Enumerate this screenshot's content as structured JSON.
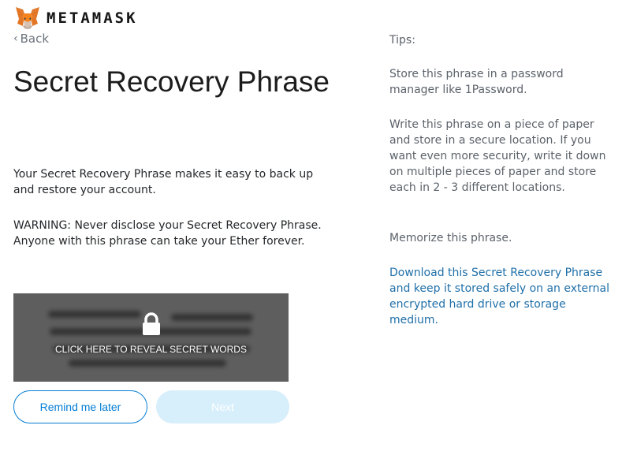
{
  "header": {
    "wordmark": "METAMASK",
    "logo_icon": "fox-icon"
  },
  "nav": {
    "back_label": "Back",
    "back_icon": "chevron-left-icon"
  },
  "main": {
    "title": "Secret Recovery Phrase",
    "description": "Your Secret Recovery Phrase makes it easy to back up and restore your account.",
    "warning": "WARNING: Never disclose your Secret Recovery Phrase. Anyone with this phrase can take your Ether forever.",
    "reveal": {
      "label": "CLICK HERE TO REVEAL SECRET WORDS",
      "icon": "lock-icon"
    },
    "buttons": {
      "remind_label": "Remind me later",
      "next_label": "Next"
    }
  },
  "tips": {
    "label": "Tips:",
    "items": [
      "Store this phrase in a password manager like 1Password.",
      "Write this phrase on a piece of paper and store in a secure location. If you want even more security, write it down on multiple pieces of paper and store each in 2 - 3 different locations.",
      "Memorize this phrase."
    ],
    "download_link": "Download this Secret Recovery Phrase and keep it stored safely on an external encrypted hard drive or storage medium."
  },
  "colors": {
    "accent": "#037dd6",
    "link": "#1f6fa8",
    "reveal_bg": "#5e5e5e",
    "next_disabled_bg": "#d7eefb"
  }
}
